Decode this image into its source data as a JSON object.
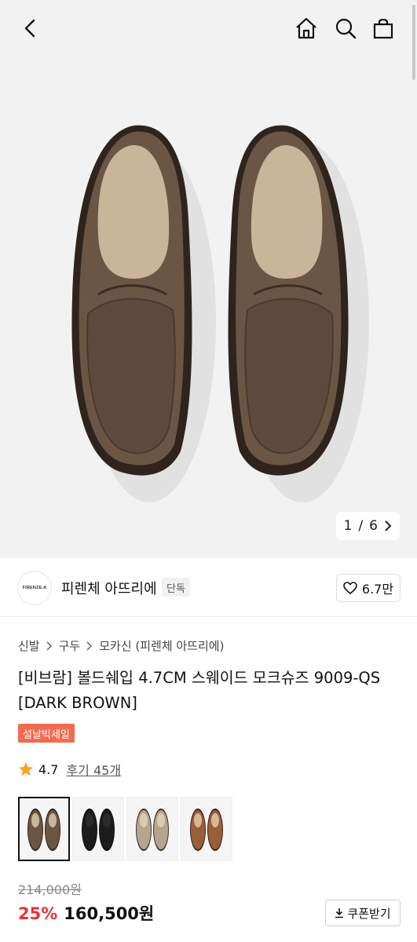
{
  "header": {
    "back_icon": "chevron-left-icon",
    "home_icon": "home-icon",
    "search_icon": "search-icon",
    "cart_icon": "shopping-bag-icon"
  },
  "gallery": {
    "current": "1",
    "separator": "/",
    "total": "6",
    "next_icon": "chevron-right-icon"
  },
  "brand": {
    "logo_text": "FIRENZE.A",
    "name": "피렌체 아뜨리에",
    "badge": "단독",
    "like_count": "6.7만"
  },
  "breadcrumb": [
    "신발",
    "구두",
    "모카신 (피렌체 아뜨리에)"
  ],
  "product": {
    "title": "[비브람] 볼드쉐입 4.7CM 스웨이드 모크슈즈 9009-QS [DARK BROWN]",
    "sale_badge": "설날빅세일",
    "rating": "4.7",
    "reviews": "후기 45개"
  },
  "color_options": [
    {
      "name": "dark-brown",
      "color": "#6b5646",
      "selected": true
    },
    {
      "name": "black",
      "color": "#1c1c1c",
      "selected": false
    },
    {
      "name": "beige",
      "color": "#b7a48f",
      "selected": false
    },
    {
      "name": "brown",
      "color": "#9a5f3a",
      "selected": false
    }
  ],
  "price": {
    "original": "214,000원",
    "discount": "25%",
    "final": "160,500원"
  },
  "coupon": {
    "label": "쿠폰받기",
    "icon": "download-icon"
  },
  "colors": {
    "accent_red": "#e8323b",
    "sale_orange": "#f26b4e",
    "star": "#f5a623"
  }
}
